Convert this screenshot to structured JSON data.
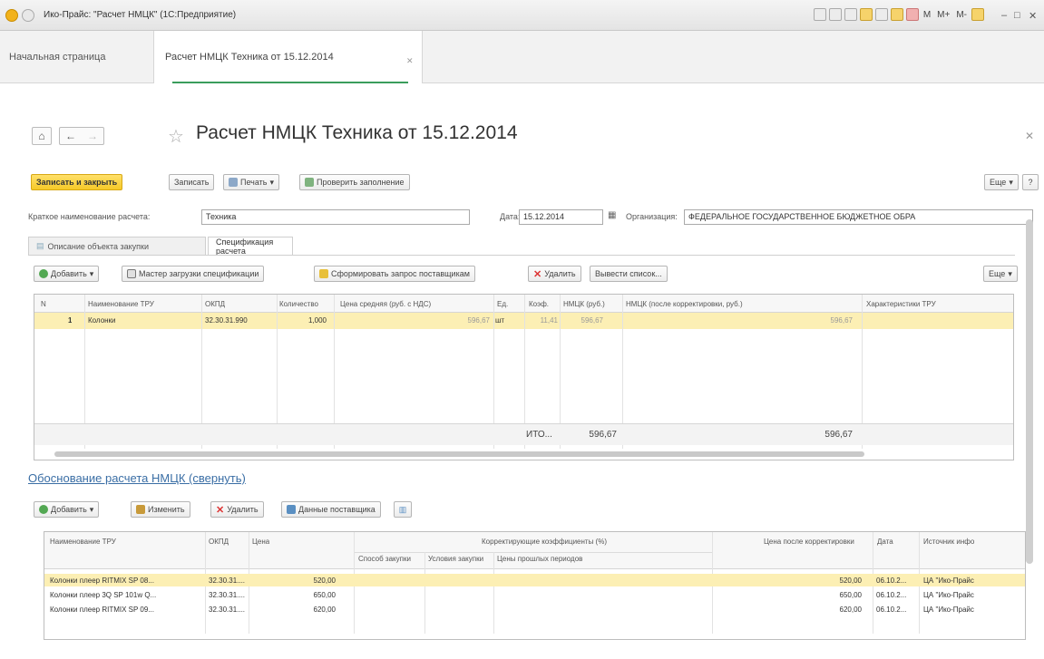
{
  "window": {
    "title": "Ико-Прайс: \"Расчет НМЦК\" (1С:Предприятие)",
    "controls": [
      "M",
      "M+",
      "M-"
    ]
  },
  "tabs": {
    "home": "Начальная страница",
    "active": "Расчет НМЦК Техника от 15.12.2014"
  },
  "form": {
    "title": "Расчет НМЦК Техника от 15.12.2014",
    "toolbar": {
      "save_close": "Записать и закрыть",
      "save": "Записать",
      "print": "Печать",
      "check": "Проверить заполнение",
      "more": "Еще",
      "help": "?"
    },
    "fields": {
      "short_name_label": "Краткое наименование расчета:",
      "short_name_value": "Техника",
      "date_label": "Дата:",
      "date_value": "15.12.2014",
      "org_label": "Организация:",
      "org_value": "ФЕДЕРАЛЬНОЕ ГОСУДАРСТВЕННОЕ БЮДЖЕТНОЕ ОБРА"
    },
    "subtabs": [
      "Описание объекта закупки",
      "Спецификация расчета"
    ]
  },
  "spec": {
    "toolbar": {
      "add": "Добавить",
      "wizard": "Мастер загрузки спецификации",
      "request": "Сформировать запрос поставщикам",
      "delete": "Удалить",
      "list": "Вывести список...",
      "more": "Еще"
    },
    "columns": [
      "N",
      "Наименование ТРУ",
      "ОКПД",
      "Количество",
      "Цена средняя (руб. с НДС)",
      "Ед.",
      "Коэф.",
      "НМЦК (руб.)",
      "НМЦК (после корректировки, руб.)",
      "Характеристики ТРУ"
    ],
    "rows": [
      {
        "n": "1",
        "name": "Колонки",
        "okpd": "32.30.31.990",
        "qty": "1,000",
        "price": "596,67",
        "unit": "шт",
        "coef": "11,41",
        "nmck": "596,67",
        "nmck_adj": "596,67",
        "chars": ""
      }
    ],
    "totals": {
      "label": "ИТО...",
      "nmck": "596,67",
      "nmck_adj": "596,67"
    }
  },
  "basis": {
    "link": "Обоснование расчета НМЦК (свернуть)",
    "toolbar": {
      "add": "Добавить",
      "edit": "Изменить",
      "delete": "Удалить",
      "supplier": "Данные поставщика"
    },
    "columns": {
      "name": "Наименование ТРУ",
      "okpd": "ОКПД",
      "price": "Цена",
      "coef_group": "Корректирующие коэффициенты (%)",
      "method": "Способ закупки",
      "terms": "Условия закупки",
      "prev": "Цены прошлых периодов",
      "adj_price": "Цена после корректировки",
      "date": "Дата",
      "source": "Источник инфо"
    },
    "rows": [
      {
        "name": "Колонки плеер RITMIX SP 08...",
        "okpd": "32.30.31....",
        "price": "520,00",
        "adj": "520,00",
        "date": "06.10.2...",
        "source": "ЦА \"Ико-Прайс"
      },
      {
        "name": "Колонки плеер 3Q SP 101w Q...",
        "okpd": "32.30.31....",
        "price": "650,00",
        "adj": "650,00",
        "date": "06.10.2...",
        "source": "ЦА \"Ико-Прайс"
      },
      {
        "name": "Колонки плеер RITMIX SP 09...",
        "okpd": "32.30.31....",
        "price": "620,00",
        "adj": "620,00",
        "date": "06.10.2...",
        "source": "ЦА \"Ико-Прайс"
      }
    ]
  }
}
